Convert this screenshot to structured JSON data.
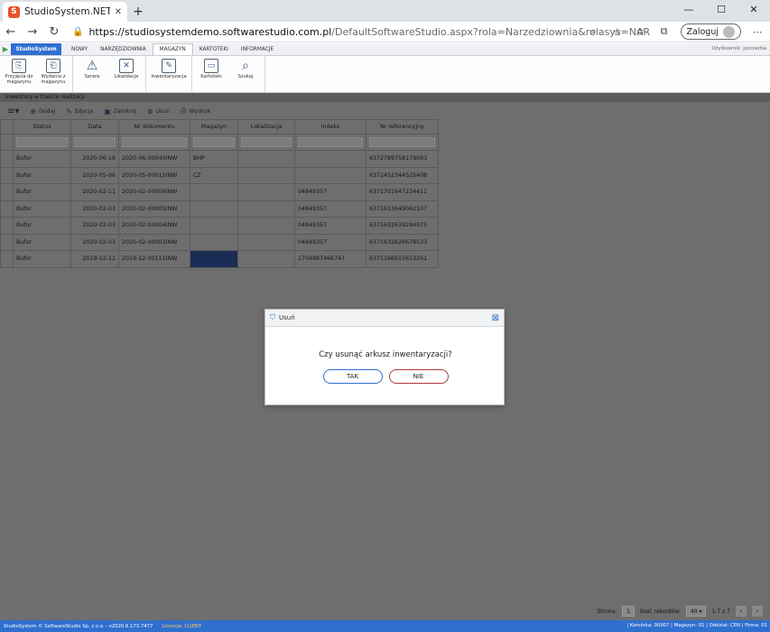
{
  "browser": {
    "tab_title": "StudioSystem.NET (c) SoftwareStu",
    "url_host": "https://studiosystemdemo.softwarestudio.com.pl",
    "url_path": "/DefaultSoftwareStudio.aspx?rola=Narzedziownia&rolasys=NAR",
    "login_label": "Zaloguj"
  },
  "app": {
    "brand": "StudioSystem",
    "tabs": [
      "NOWY",
      "NARZĘDZIOWNIA",
      "MAGAZYN",
      "KARTOTEKI",
      "INFORMACJE"
    ],
    "active_tab": "MAGAZYN",
    "user_label": "Użytkownik: jszczerba"
  },
  "ribbon": {
    "groups": [
      [
        {
          "label": "Przyjęcia do magazynu",
          "icon": "document-in-icon"
        },
        {
          "label": "Wydania z magazynu",
          "icon": "document-out-icon"
        }
      ],
      [
        {
          "label": "Serwis",
          "icon": "warning-icon"
        },
        {
          "label": "Likwidacje",
          "icon": "delete-doc-icon"
        }
      ],
      [
        {
          "label": "Inwentaryzacja",
          "icon": "edit-icon"
        }
      ],
      [
        {
          "label": "Kartoteki",
          "icon": "inbox-icon"
        },
        {
          "label": "Szukaj",
          "icon": "search-icon"
        }
      ]
    ]
  },
  "page": {
    "subtitle": "Inwentury w trakcie realizacji",
    "toolbar": [
      "Dodaj",
      "Edycja",
      "Zamknij",
      "Usuń",
      "Wydruk"
    ]
  },
  "grid": {
    "columns": [
      "Status",
      "Data",
      "Nr dokumentu",
      "Magazyn",
      "Lokalizacja",
      "Indeks",
      "Nr referencyjny"
    ],
    "rows": [
      [
        "Bufor",
        "2020-06-16",
        "2020-06-00040INW",
        "BHP",
        "",
        "",
        "6372789758179093"
      ],
      [
        "Bufor",
        "2020-05-06",
        "2020-05-00015INW",
        "CZ",
        "",
        "",
        "6372452344525408"
      ],
      [
        "Bufor",
        "2020-02-11",
        "2020-02-00006INW",
        "",
        "",
        "04849357",
        "6371701947234411"
      ],
      [
        "Bufor",
        "2020-02-03",
        "2020-02-00005INW",
        "",
        "",
        "04849357",
        "6371633649062107"
      ],
      [
        "Bufor",
        "2020-02-03",
        "2020-02-00004INW",
        "",
        "",
        "04849357",
        "6371632639294975"
      ],
      [
        "Bufor",
        "2020-02-03",
        "2020-02-00003INW",
        "",
        "",
        "04849357",
        "6371632626679533"
      ],
      [
        "Bufor",
        "2019-12-11",
        "2019-12-00111INW",
        "",
        "",
        "1704887466747",
        "6371166915613261"
      ]
    ]
  },
  "modal": {
    "title": "Usuń",
    "message": "Czy usunąć arkusz inwentaryzacji?",
    "yes_label": "TAK",
    "no_label": "NIE"
  },
  "pager": {
    "page_label": "Strona:",
    "page_value": "1",
    "per_page_label": "Ilość rekordów:",
    "per_page_value": "40",
    "range": "1-7 z 7"
  },
  "status": {
    "left": "StudioSystem © SoftwareStudio Sp. z o.o. - v2020.6.173.7477",
    "license": "Licencja: CLIENT",
    "right": "| Komórka: 00007 | Magazyn: 01 | Oddział: CEN | Firma: 01"
  }
}
